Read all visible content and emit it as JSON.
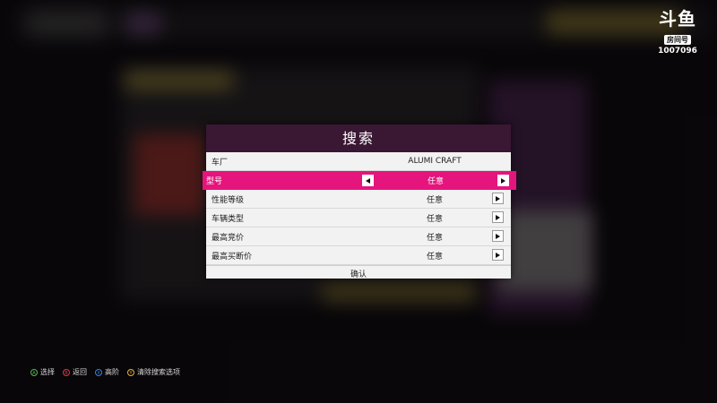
{
  "watermark": {
    "logo": "斗鱼",
    "room_label": "房间号",
    "room_id": "1007096"
  },
  "dialog": {
    "title": "搜索",
    "rows": [
      {
        "label": "车厂",
        "value": "ALUMI CRAFT",
        "has_arrow": false,
        "selected": false
      },
      {
        "label": "型号",
        "value": "任意",
        "has_arrow": true,
        "selected": true
      },
      {
        "label": "性能等级",
        "value": "任意",
        "has_arrow": true,
        "selected": false
      },
      {
        "label": "车辆类型",
        "value": "任意",
        "has_arrow": true,
        "selected": false
      },
      {
        "label": "最高竞价",
        "value": "任意",
        "has_arrow": true,
        "selected": false
      },
      {
        "label": "最高买断价",
        "value": "任意",
        "has_arrow": true,
        "selected": false
      }
    ],
    "confirm": "确认"
  },
  "hints": [
    {
      "key": "A",
      "label": "选择"
    },
    {
      "key": "B",
      "label": "返回"
    },
    {
      "key": "X",
      "label": "高阶"
    },
    {
      "key": "Y",
      "label": "清除搜索选项"
    }
  ],
  "colors": {
    "accent": "#e6147d",
    "title_bar": "#3a1733",
    "panel": "#f2f2f2"
  }
}
